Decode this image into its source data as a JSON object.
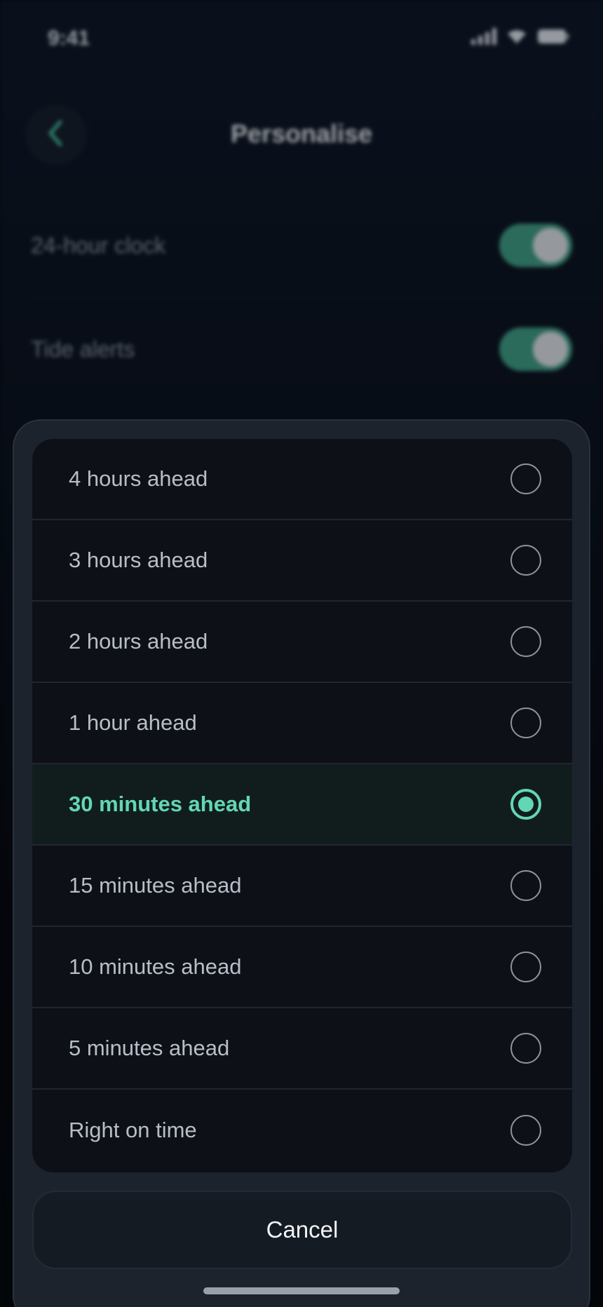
{
  "status_bar": {
    "time": "9:41"
  },
  "header": {
    "title": "Personalise"
  },
  "settings": [
    {
      "label": "24-hour clock",
      "enabled": true
    },
    {
      "label": "Tide alerts",
      "enabled": true
    }
  ],
  "sheet": {
    "options": [
      {
        "label": "4 hours ahead",
        "selected": false
      },
      {
        "label": "3 hours ahead",
        "selected": false
      },
      {
        "label": "2 hours ahead",
        "selected": false
      },
      {
        "label": "1 hour ahead",
        "selected": false
      },
      {
        "label": "30 minutes ahead",
        "selected": true
      },
      {
        "label": "15 minutes ahead",
        "selected": false
      },
      {
        "label": "10 minutes ahead",
        "selected": false
      },
      {
        "label": "5 minutes ahead",
        "selected": false
      },
      {
        "label": "Right on time",
        "selected": false
      }
    ],
    "cancel_label": "Cancel"
  },
  "colors": {
    "accent": "#63d6b6",
    "toggle_on": "#3a8f7a",
    "sheet_bg": "#1c232d",
    "card_bg": "#0d1117"
  }
}
